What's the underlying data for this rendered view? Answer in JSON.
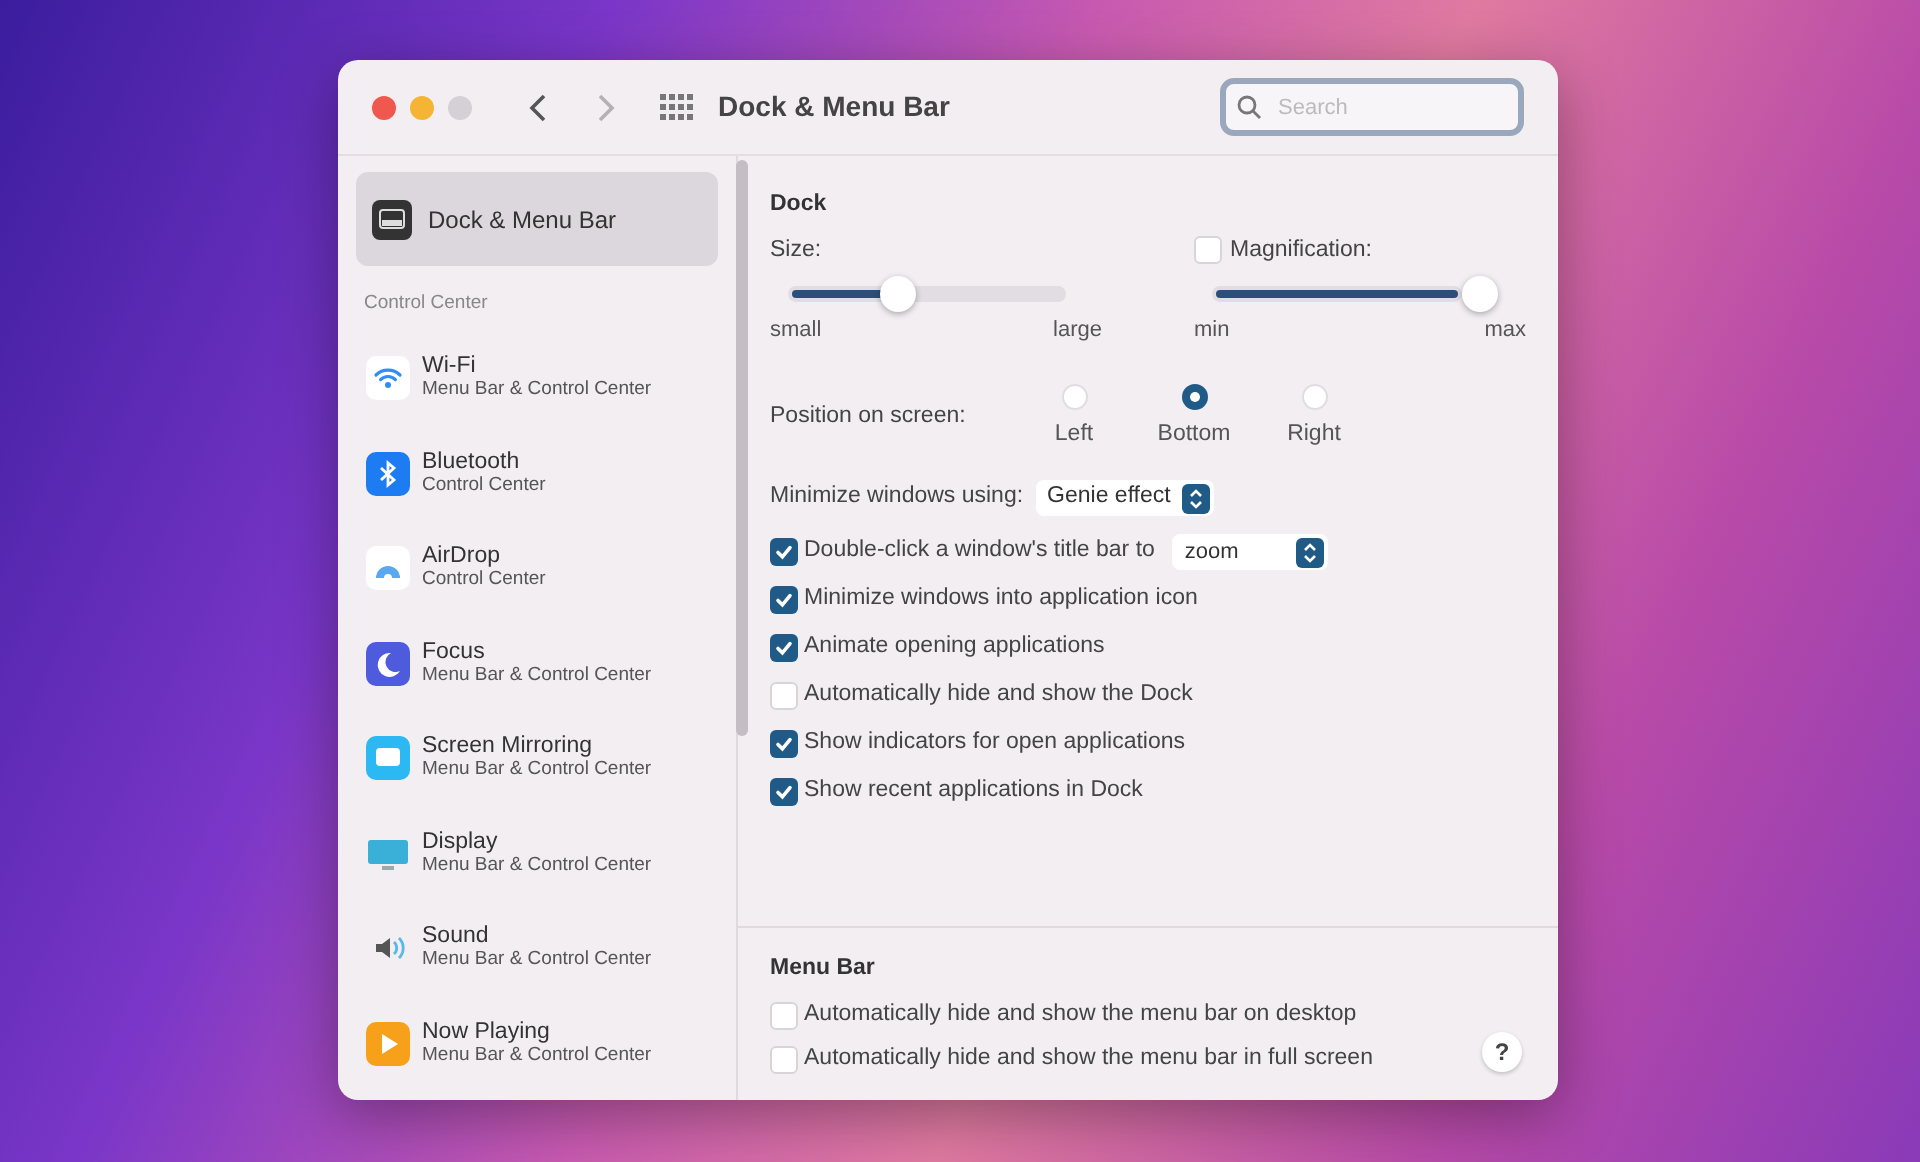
{
  "window": {
    "title": "Dock & Menu Bar",
    "search": {
      "placeholder": "Search"
    }
  },
  "sidebar": {
    "top_item": {
      "label": "Dock & Menu Bar",
      "selected": true
    },
    "section": "Control Center",
    "items": [
      {
        "label": "Wi-Fi",
        "subtitle": "Menu Bar & Control Center",
        "selected": false
      },
      {
        "label": "Bluetooth",
        "subtitle": "Control Center",
        "selected": false
      },
      {
        "label": "AirDrop",
        "subtitle": "Control Center",
        "selected": false
      },
      {
        "label": "Focus",
        "subtitle": "Menu Bar & Control Center",
        "selected": false
      },
      {
        "label": "Screen Mirroring",
        "subtitle": "Menu Bar & Control Center",
        "selected": false
      },
      {
        "label": "Display",
        "subtitle": "Menu Bar & Control Center",
        "selected": false
      },
      {
        "label": "Sound",
        "subtitle": "Menu Bar & Control Center",
        "selected": false
      },
      {
        "label": "Now Playing",
        "subtitle": "Menu Bar & Control Center",
        "selected": false
      }
    ]
  },
  "dock": {
    "title": "Dock",
    "size": {
      "label": "Size:",
      "level": 0.37,
      "min_label": "small",
      "max_label": "large"
    },
    "magnification": {
      "label": "Magnification:",
      "checked": false,
      "level": 1.0,
      "min_label": "min",
      "max_label": "max"
    },
    "position": {
      "label": "Position on screen:",
      "options": [
        {
          "label": "Left",
          "selected": false
        },
        {
          "label": "Bottom",
          "selected": true
        },
        {
          "label": "Right",
          "selected": false
        }
      ]
    },
    "minimize": {
      "label": "Minimize windows using:",
      "value": "Genie effect"
    },
    "options": [
      {
        "label": "Double-click a window's title bar to",
        "checked": true,
        "value": "zoom"
      },
      {
        "label": "Minimize windows into application icon",
        "checked": true
      },
      {
        "label": "Animate opening applications",
        "checked": true
      },
      {
        "label": "Automatically hide and show the Dock",
        "checked": false
      },
      {
        "label": "Show indicators for open applications",
        "checked": true
      },
      {
        "label": "Show recent applications in Dock",
        "checked": true
      }
    ]
  },
  "menu_bar": {
    "title": "Menu Bar",
    "options": [
      {
        "label": "Automatically hide and show the menu bar on desktop",
        "checked": false
      },
      {
        "label": "Automatically hide and show the menu bar in full screen",
        "checked": false
      }
    ]
  },
  "help": "?"
}
